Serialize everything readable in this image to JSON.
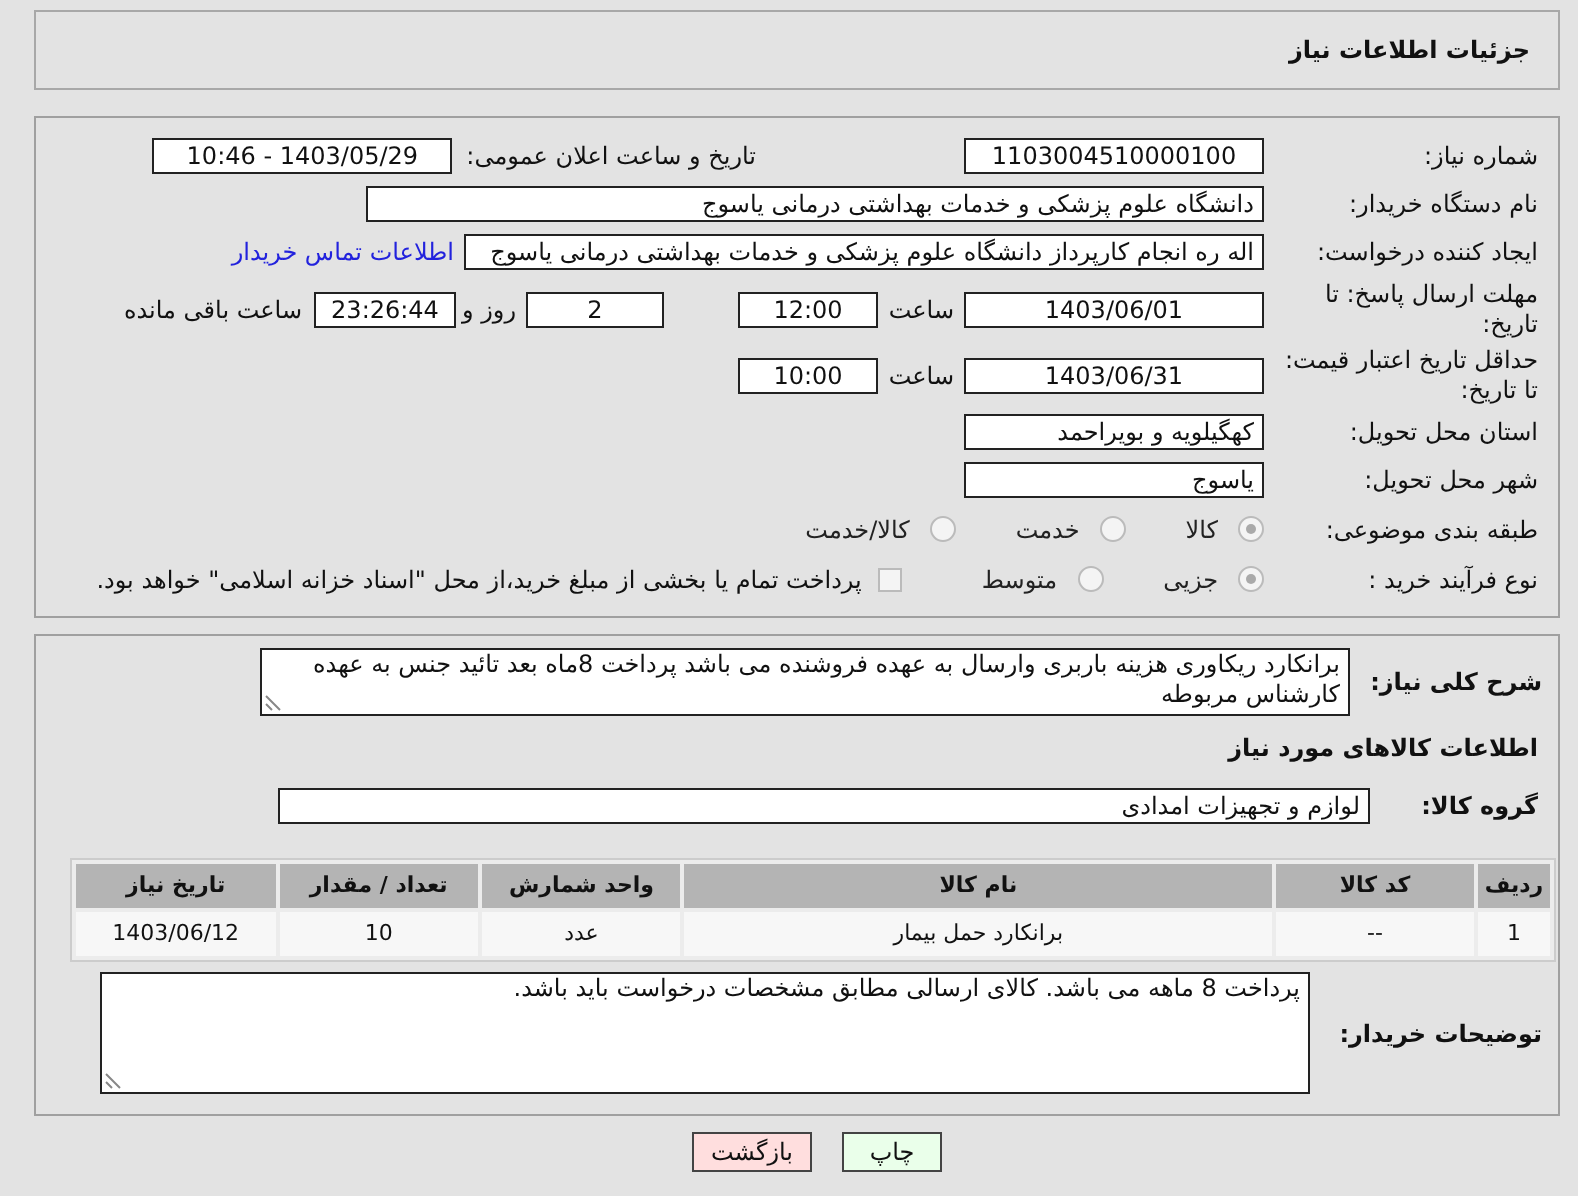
{
  "page_title": "جزئیات اطلاعات نیاز",
  "need_number": {
    "label": "شماره نیاز:",
    "value": "1103004510000100"
  },
  "announce_datetime": {
    "label": "تاریخ و ساعت اعلان عمومی:",
    "value": "1403/05/29 - 10:46"
  },
  "buyer_org": {
    "label": "نام دستگاه خریدار:",
    "value": "دانشگاه علوم پزشکی و خدمات بهداشتی  درمانی یاسوج"
  },
  "requester": {
    "label": "ایجاد کننده درخواست:",
    "value": "اله ره انجام کارپرداز دانشگاه علوم پزشکی و خدمات بهداشتی  درمانی یاسوج",
    "contact_link": "اطلاعات تماس خریدار"
  },
  "response_deadline": {
    "label": "مهلت ارسال پاسخ: تا تاریخ:",
    "date": "1403/06/01",
    "time_label": "ساعت",
    "time": "12:00",
    "days": "2",
    "days_label": "روز و",
    "remaining": "23:26:44",
    "remaining_label": "ساعت باقی مانده"
  },
  "price_validity": {
    "label": "حداقل تاریخ اعتبار قیمت: تا تاریخ:",
    "date": "1403/06/31",
    "time_label": "ساعت",
    "time": "10:00"
  },
  "delivery_province": {
    "label": "استان محل تحویل:",
    "value": "کهگیلویه و بویراحمد"
  },
  "delivery_city": {
    "label": "شهر محل تحویل:",
    "value": "یاسوج"
  },
  "category": {
    "label": "طبقه بندی موضوعی:",
    "options": [
      {
        "label": "کالا",
        "selected": true
      },
      {
        "label": "خدمت",
        "selected": false
      },
      {
        "label": "کالا/خدمت",
        "selected": false
      }
    ]
  },
  "purchase_process": {
    "label": "نوع فرآیند خرید :",
    "options": [
      {
        "label": "جزیی",
        "selected": true
      },
      {
        "label": "متوسط",
        "selected": false
      }
    ],
    "treasury_payment": {
      "label": "پرداخت تمام یا بخشی از مبلغ خرید،از محل \"اسناد خزانه اسلامی\" خواهد بود.",
      "checked": false
    }
  },
  "summary": {
    "label": "شرح کلی نیاز:",
    "value": "برانکارد ریکاوری هزینه باربری وارسال به عهده فروشنده می باشد پرداخت 8ماه بعد تائید جنس به عهده کارشناس مربوطه"
  },
  "goods_heading": "اطلاعات کالاهای مورد نیاز",
  "goods_group": {
    "label": "گروه کالا:",
    "value": "لوازم و تجهیزات امدادی"
  },
  "table": {
    "columns": [
      "ردیف",
      "کد کالا",
      "نام کالا",
      "واحد شمارش",
      "تعداد / مقدار",
      "تاریخ نیاز"
    ],
    "rows": [
      [
        "1",
        "--",
        "برانکارد حمل بیمار",
        "عدد",
        "10",
        "1403/06/12"
      ]
    ]
  },
  "buyer_notes": {
    "label": "توضیحات خریدار:",
    "value": "پرداخت 8 ماهه می باشد. کالای ارسالی مطابق مشخصات درخواست باید باشد."
  },
  "buttons": [
    {
      "label": "چاپ",
      "kind": "print"
    },
    {
      "label": "بازگشت",
      "kind": "back"
    }
  ]
}
